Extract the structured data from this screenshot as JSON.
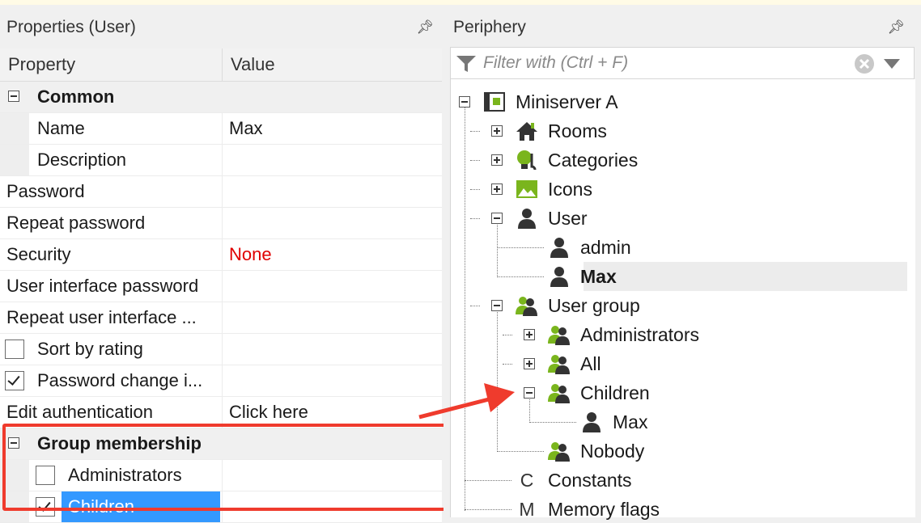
{
  "left_panel": {
    "title": "Properties (User)",
    "headers": {
      "property": "Property",
      "value": "Value"
    },
    "common": {
      "label": "Common"
    },
    "name_row": {
      "label": "Name",
      "value": "Max"
    },
    "description_row": {
      "label": "Description",
      "value": ""
    },
    "password_row": {
      "label": "Password",
      "value": ""
    },
    "repeat_password_row": {
      "label": "Repeat password",
      "value": ""
    },
    "security_row": {
      "label": "Security",
      "value": "None"
    },
    "ui_password_row": {
      "label": "User interface password",
      "value": ""
    },
    "repeat_ui_row": {
      "label": "Repeat user interface ...",
      "value": ""
    },
    "sort_row": {
      "label": "Sort by rating",
      "checked": false
    },
    "pwchange_row": {
      "label": "Password change i...",
      "checked": true
    },
    "edit_auth_row": {
      "label": "Edit authentication",
      "value": "Click here"
    },
    "group_membership": {
      "label": "Group membership"
    },
    "membership_admin": {
      "label": "Administrators",
      "checked": false
    },
    "membership_children": {
      "label": "Children",
      "checked": true
    }
  },
  "right_panel": {
    "title": "Periphery",
    "filter_placeholder": "Filter with (Ctrl + F)",
    "tree": {
      "miniserver": "Miniserver A",
      "rooms": "Rooms",
      "categories": "Categories",
      "icons": "Icons",
      "user": "User",
      "user_admin": "admin",
      "user_max": "Max",
      "user_group": "User group",
      "grp_admins": "Administrators",
      "grp_all": "All",
      "grp_children": "Children",
      "grp_children_max": "Max",
      "grp_nobody": "Nobody",
      "constants": "Constants",
      "constants_letter": "C",
      "memory": "Memory flags",
      "memory_letter": "M"
    }
  },
  "colors": {
    "accent_selection": "#3399ff",
    "callout": "#ef3b2d",
    "icon_green": "#7ab51d",
    "security_none": "#e00000"
  }
}
